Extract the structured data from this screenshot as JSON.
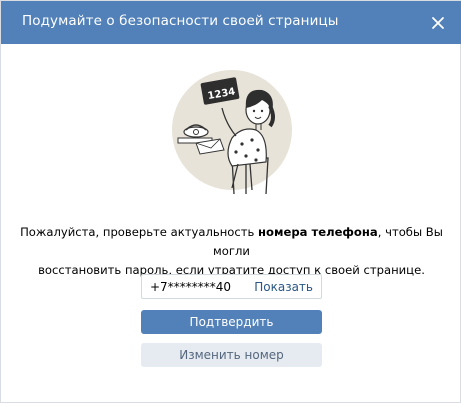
{
  "colors": {
    "header_bg": "#5181b8",
    "primary_button": "#5181b8",
    "secondary_button": "#e5ebf1",
    "link": "#2a5885"
  },
  "dialog": {
    "title": "Подумайте о безопасности своей страницы",
    "close_icon": "close-icon"
  },
  "illustration": {
    "sign_text": "1234"
  },
  "message": {
    "before": "Пожалуйста, проверьте актуальность ",
    "bold": "номера телефона",
    "after_line1": ", чтобы Вы могли",
    "line2": "восстановить пароль, если утратите доступ к своей странице."
  },
  "phone": {
    "value": "+7********40",
    "show_label": "Показать"
  },
  "buttons": {
    "confirm_label": "Подтвердить",
    "change_label": "Изменить номер"
  }
}
